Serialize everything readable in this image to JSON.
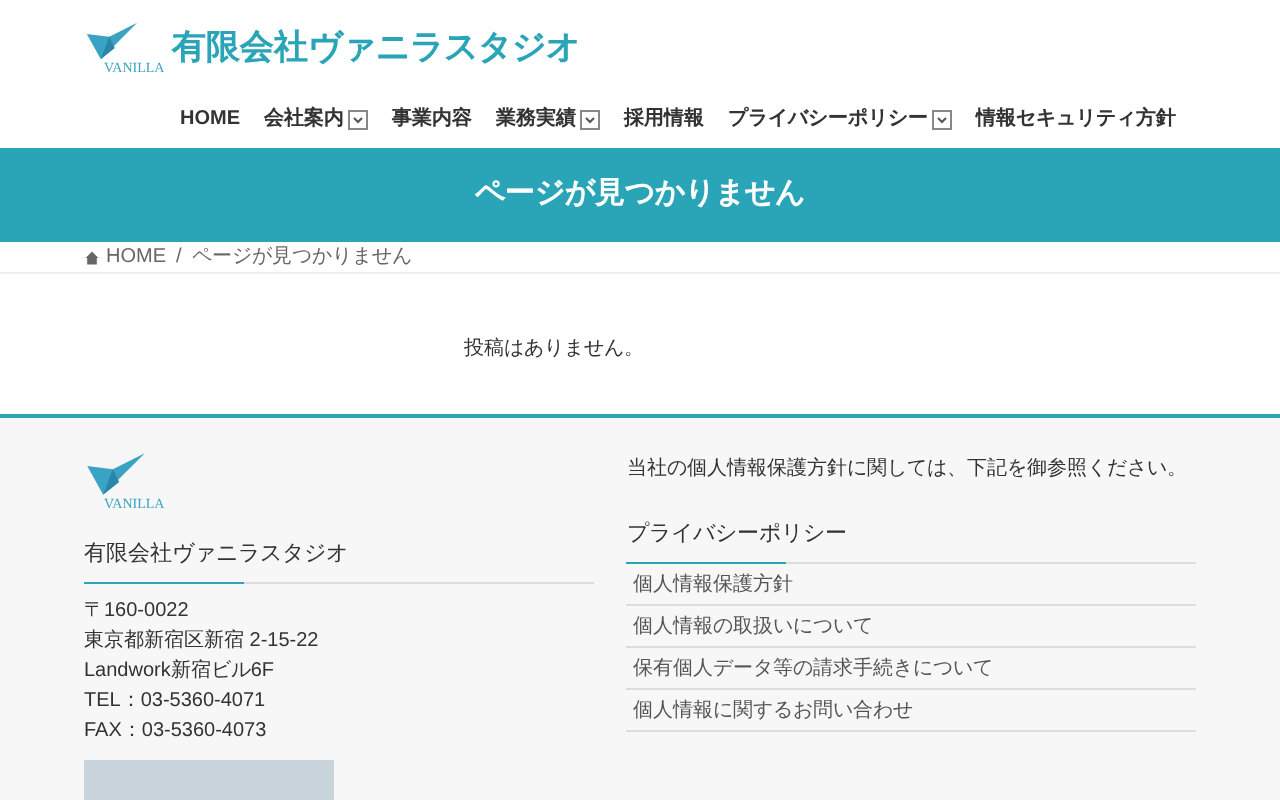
{
  "header": {
    "site_title": "有限会社ヴァニラスタジオ",
    "logo_text": "VANILLA"
  },
  "nav": [
    {
      "label": "HOME",
      "has_submenu": false
    },
    {
      "label": "会社案内",
      "has_submenu": true
    },
    {
      "label": "事業内容",
      "has_submenu": false
    },
    {
      "label": "業務実績",
      "has_submenu": true
    },
    {
      "label": "採用情報",
      "has_submenu": false
    },
    {
      "label": "プライバシーポリシー",
      "has_submenu": true
    },
    {
      "label": "情報セキュリティ方針",
      "has_submenu": false
    }
  ],
  "page_title": "ページが見つかりません",
  "breadcrumb": [
    "HOME",
    "ページが見つかりません"
  ],
  "breadcrumb_separator": "/",
  "message": "投稿はありません。",
  "footer": {
    "logo_text": "VANILLA",
    "company": "有限会社ヴァニラスタジオ",
    "address_lines": [
      "〒160-0022",
      "東京都新宿区新宿 2-15-22",
      "Landwork新宿ビル6F",
      "TEL：03-5360-4071",
      "FAX：03-5360-4073"
    ],
    "privacy_intro": "当社の個人情報保護方針に関しては、下記を御参照ください。",
    "privacy_heading": "プライバシーポリシー",
    "privacy_links": [
      "個人情報保護方針",
      "個人情報の取扱いについて",
      "保有個人データ等の請求手続きについて",
      "個人情報に関するお問い合わせ"
    ]
  }
}
